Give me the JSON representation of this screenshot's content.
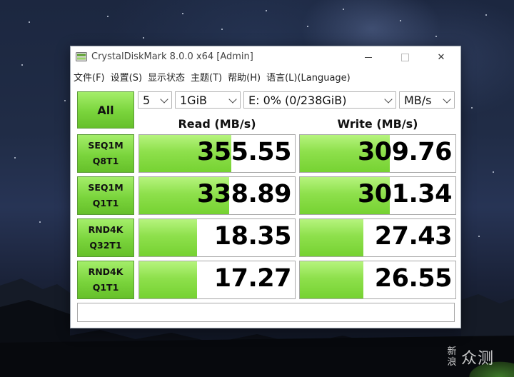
{
  "window": {
    "title": "CrystalDiskMark 8.0.0 x64 [Admin]",
    "close_glyph": "✕"
  },
  "menu": [
    "文件(F)",
    "设置(S)",
    "显示状态",
    "主题(T)",
    "帮助(H)",
    "语言(L)(Language)"
  ],
  "controls": {
    "all_label": "All",
    "count": "5",
    "size": "1GiB",
    "drive": "E: 0% (0/238GiB)",
    "unit": "MB/s"
  },
  "headers": {
    "read": "Read (MB/s)",
    "write": "Write (MB/s)"
  },
  "tests": [
    {
      "line1": "SEQ1M",
      "line2": "Q8T1",
      "read": "355.55",
      "write": "309.76",
      "read_fill": 0.59,
      "write_fill": 0.58
    },
    {
      "line1": "SEQ1M",
      "line2": "Q1T1",
      "read": "338.89",
      "write": "301.34",
      "read_fill": 0.58,
      "write_fill": 0.58
    },
    {
      "line1": "RND4K",
      "line2": "Q32T1",
      "read": "18.35",
      "write": "27.43",
      "read_fill": 0.37,
      "write_fill": 0.41
    },
    {
      "line1": "RND4K",
      "line2": "Q1T1",
      "read": "17.27",
      "write": "26.55",
      "read_fill": 0.37,
      "write_fill": 0.41
    }
  ],
  "comment": "",
  "watermark": {
    "stack": [
      "新",
      "浪"
    ],
    "word": "众测"
  },
  "colors": {
    "accent_green": "#7ad43c",
    "bar_green": "#8ee04c"
  }
}
